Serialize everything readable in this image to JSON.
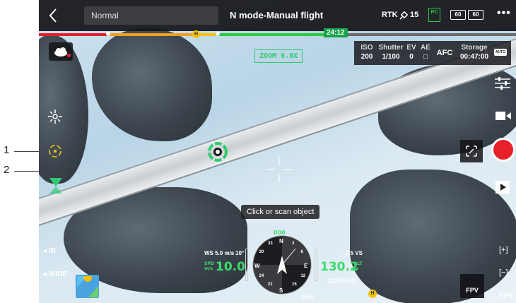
{
  "callouts": {
    "one": "1",
    "two": "2"
  },
  "topbar": {
    "mode_value": "Normal",
    "title": "N mode-Manual flight",
    "rtk_label": "RTK",
    "rtk_count": "15",
    "rc_label": "RC",
    "battery_1": "60",
    "battery_2": "60",
    "more": "•••"
  },
  "progress": {
    "remaining_time": "24:12",
    "home_marker": "H"
  },
  "camera": {
    "iso_label": "ISO",
    "iso_value": "200",
    "shutter_label": "Shutter",
    "shutter_value": "1/100",
    "ev_label": "EV",
    "ev_value": "0",
    "ae_label": "AE",
    "focus_mode": "AFC",
    "storage_label": "Storage",
    "storage_value": "00:47:00",
    "auto_badge": "AUTO"
  },
  "zoom_label": "ZOOM 6.0X",
  "scan_tip": "Click or scan object",
  "left_panel": {
    "ir_label": "IR",
    "wide_label": "WIDE"
  },
  "right_panel": {
    "zoom_in": "[+]",
    "zoom_out": "[−]",
    "fpv_label": "FPV"
  },
  "fpv_button_label": "FPV",
  "nav": {
    "heading_value": "000",
    "wind": "WS 5.0 m/s",
    "wind_dir": "10°",
    "speed_unit": "SPD m/s",
    "speed_value": "10.0",
    "vs": "2.5 VS",
    "alt_unit": "ALT m",
    "alt_value": "130.2",
    "asl": "1126.5 ASL",
    "distance": "43m",
    "north": "N",
    "east": "E",
    "south": "S",
    "west": "W",
    "bearing_ticks": [
      "3",
      "6",
      "12",
      "15",
      "21",
      "24",
      "30",
      "33"
    ]
  },
  "colors": {
    "accent_green": "#3ddc6e",
    "record_red": "#e8202a",
    "home_yellow": "#f4c20d"
  }
}
